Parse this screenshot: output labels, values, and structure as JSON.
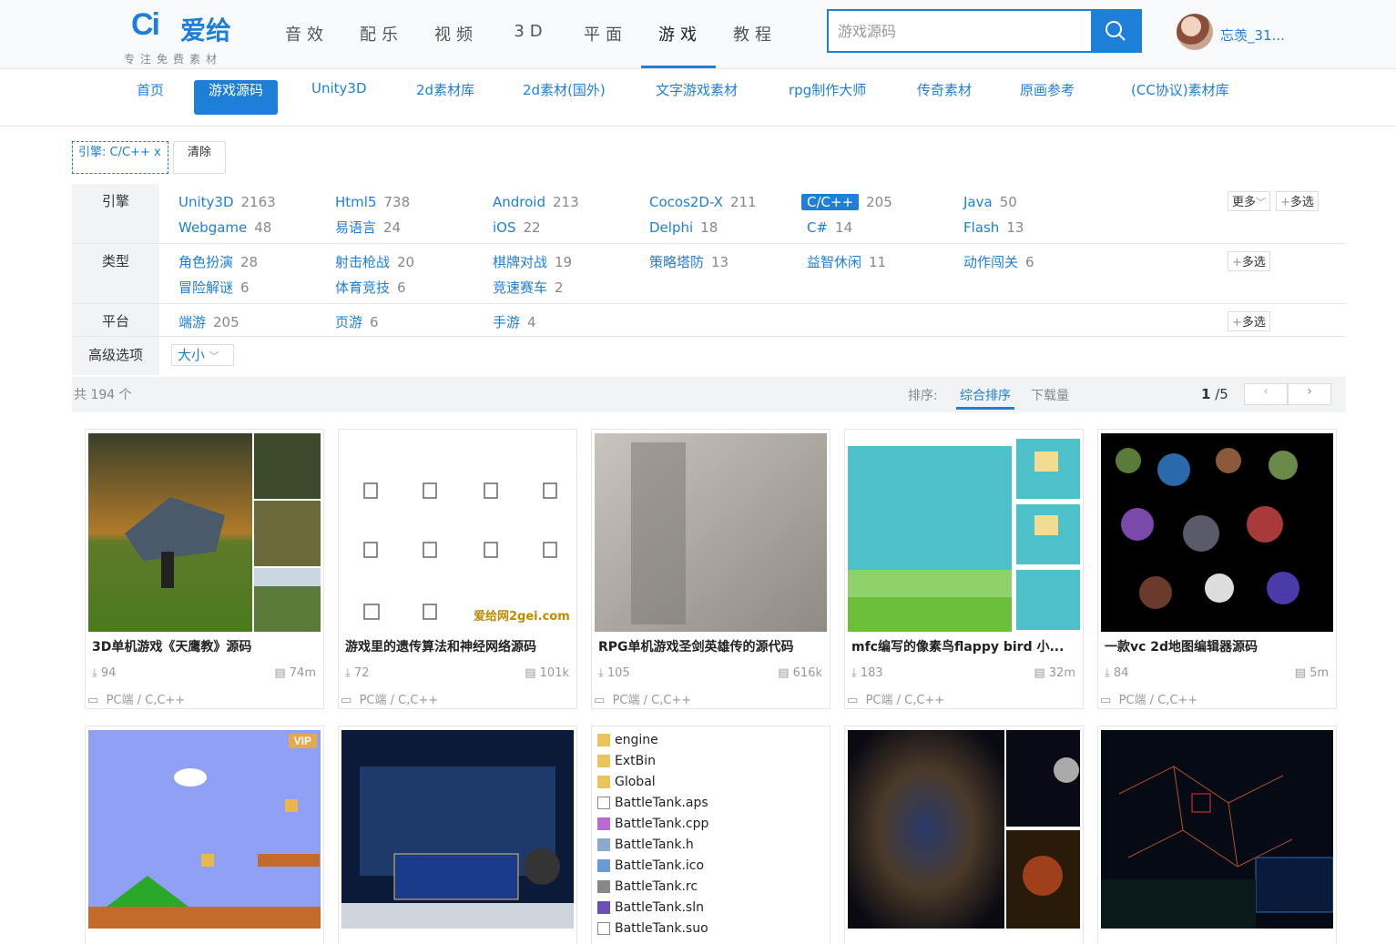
{
  "header": {
    "logo_mark": "Ci",
    "logo_text": "爱给",
    "slogan": "专注免费素材",
    "nav": [
      "音效",
      "配乐",
      "视频",
      "3D",
      "平面",
      "游戏",
      "教程"
    ],
    "active_nav": "游戏",
    "search_placeholder": "游戏源码",
    "username": "忘羡_31..."
  },
  "subnav": [
    "首页",
    "游戏源码",
    "Unity3D",
    "2d素材库",
    "2d素材(国外)",
    "文字游戏素材",
    "rpg制作大师",
    "传奇素材",
    "原画参考",
    "(CC协议)素材库"
  ],
  "subnav_active": "游戏源码",
  "selected_filter": "引擎: C/C++ x",
  "clear_label": "清除",
  "filters": {
    "engine": {
      "label": "引擎",
      "options": [
        {
          "name": "Unity3D",
          "count": "2163"
        },
        {
          "name": "Html5",
          "count": "738"
        },
        {
          "name": "Android",
          "count": "213"
        },
        {
          "name": "Cocos2D-X",
          "count": "211"
        },
        {
          "name": "C/C++",
          "count": "205"
        },
        {
          "name": "Java",
          "count": "50"
        },
        {
          "name": "Webgame",
          "count": "48"
        },
        {
          "name": "易语言",
          "count": "24"
        },
        {
          "name": "iOS",
          "count": "22"
        },
        {
          "name": "Delphi",
          "count": "18"
        },
        {
          "name": "C#",
          "count": "14"
        },
        {
          "name": "Flash",
          "count": "13"
        }
      ],
      "more_label": "更多",
      "multi_label": "多选"
    },
    "type": {
      "label": "类型",
      "options": [
        {
          "name": "角色扮演",
          "count": "28"
        },
        {
          "name": "射击枪战",
          "count": "20"
        },
        {
          "name": "棋牌对战",
          "count": "19"
        },
        {
          "name": "策略塔防",
          "count": "13"
        },
        {
          "name": "益智休闲",
          "count": "11"
        },
        {
          "name": "动作闯关",
          "count": "6"
        },
        {
          "name": "冒险解谜",
          "count": "6"
        },
        {
          "name": "体育竞技",
          "count": "6"
        },
        {
          "name": "竞速赛车",
          "count": "2"
        }
      ],
      "multi_label": "多选"
    },
    "platform": {
      "label": "平台",
      "options": [
        {
          "name": "端游",
          "count": "205"
        },
        {
          "name": "页游",
          "count": "6"
        },
        {
          "name": "手游",
          "count": "4"
        }
      ],
      "multi_label": "多选"
    },
    "advanced": {
      "label": "高级选项",
      "size_label": "大小"
    }
  },
  "results": {
    "total": "共 194 个",
    "sort_label": "排序:",
    "sort_options": [
      "综合排序",
      "下载量"
    ],
    "active_sort": "综合排序",
    "page_current": "1",
    "page_total": "/5"
  },
  "cards": [
    {
      "title": "3D单机游戏《天鹰教》源码",
      "downloads": "94",
      "size": "74m",
      "tags": "PC端 / C,C++"
    },
    {
      "title": "游戏里的遗传算法和神经网络源码",
      "downloads": "72",
      "size": "101k",
      "tags": "PC端 / C,C++"
    },
    {
      "title": "RPG单机游戏圣剑英雄传的源代码",
      "downloads": "105",
      "size": "616k",
      "tags": "PC端 / C,C++"
    },
    {
      "title": "mfc编写的像素鸟flappy bird 小...",
      "downloads": "183",
      "size": "32m",
      "tags": "PC端 / C,C++"
    },
    {
      "title": "一款vc 2d地图编辑器源码",
      "downloads": "84",
      "size": "5m",
      "tags": "PC端 / C,C++"
    },
    {
      "title": "",
      "vip": "VIP"
    },
    {
      "title": ""
    },
    {
      "title": "",
      "files": [
        "engine",
        "ExtBin",
        "Global",
        "BattleTank.aps",
        "BattleTank.cpp",
        "BattleTank.h",
        "BattleTank.ico",
        "BattleTank.rc",
        "BattleTank.sln",
        "BattleTank.suo"
      ]
    },
    {
      "title": ""
    },
    {
      "title": ""
    }
  ],
  "watermark": "爱给网2gei.com"
}
